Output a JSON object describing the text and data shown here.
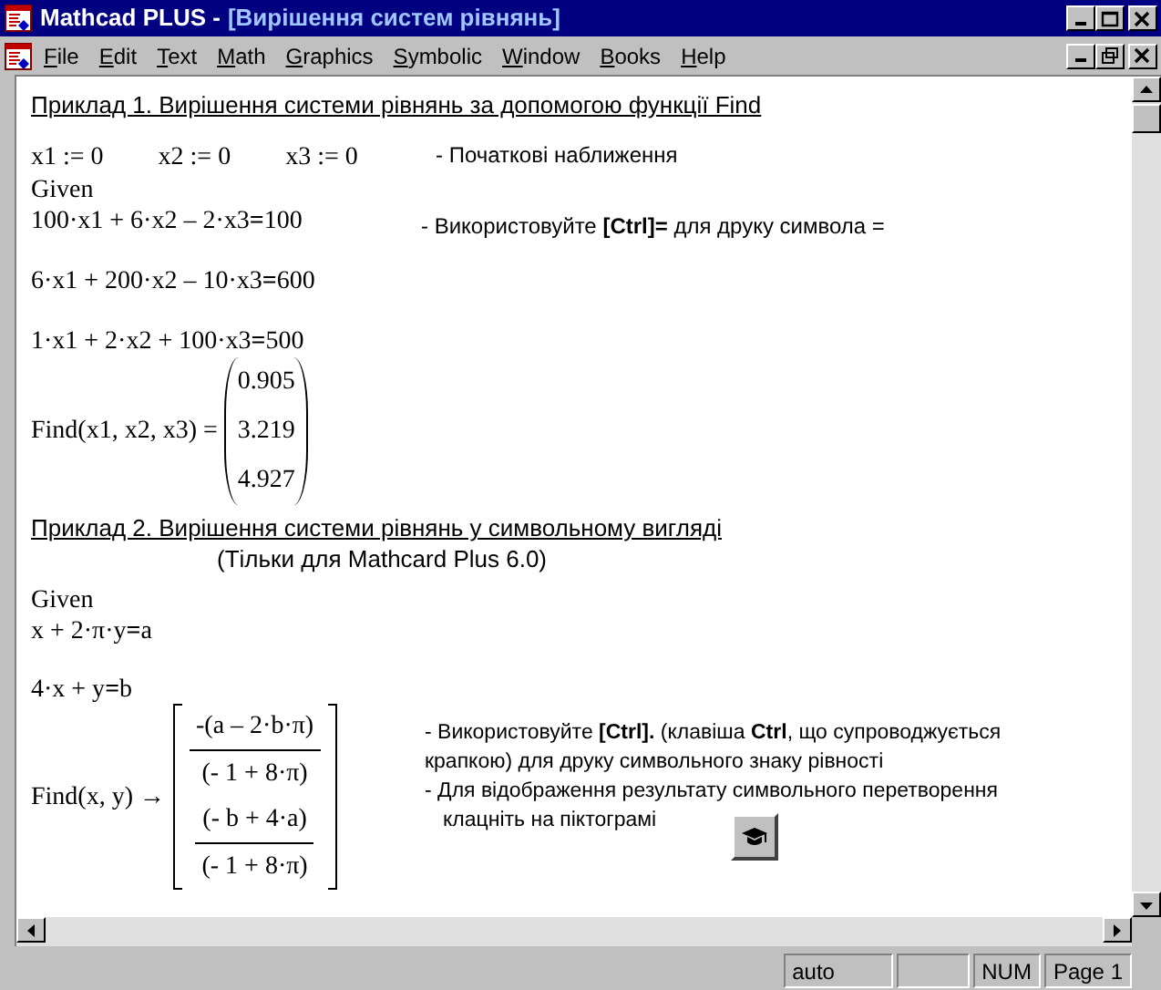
{
  "window": {
    "app_title": "Mathcad PLUS -",
    "document_title": "[Вирішення систем рівнянь]"
  },
  "menu": [
    "File",
    "Edit",
    "Text",
    "Math",
    "Graphics",
    "Symbolic",
    "Window",
    "Books",
    "Help"
  ],
  "example_1": {
    "heading": "Приклад 1. Вирішення системи рівнянь за допомогою функції Find",
    "assignments": [
      "x1 := 0",
      "x2 := 0",
      "x3 := 0"
    ],
    "note": "- Початкові наближення",
    "given": "Given",
    "equations": [
      "100·x1 + 6·x2 – 2·x3**=**100",
      "6·x1 + 200·x2 – 10·x3**=**600",
      "1·x1 + 2·x2 + 100·x3**=**500"
    ],
    "hint": "- Використовуйте **[Ctrl]=** для друку символа =",
    "find": "Find(x1, x2, x3) =",
    "result": [
      "0.905",
      "3.219",
      "4.927"
    ]
  },
  "example_2": {
    "heading": "Приклад 2. Вирішення системи рівнянь у символьному вигляді",
    "subtitle": "(Тільки для Mathcard Plus 6.0)",
    "given": "Given",
    "equations": [
      "x + 2·π·y**=**a",
      "4·x + y**=**b"
    ],
    "find": "Find(x, y) →",
    "result": [
      {
        "numerator": "-(a – 2·b·π)",
        "denominator": "(- 1 + 8·π)"
      },
      {
        "numerator": "(- b + 4·a)",
        "denominator": "(- 1 + 8·π)"
      }
    ],
    "notes": [
      "- Використовуйте **[Ctrl].** (клавіша **Ctrl**, що супроводжується крапкою) для друку символьного знаку рівності",
      "- Для відображення результату символьного перетворення клацніть на піктограмі"
    ]
  },
  "status_bar": [
    "auto",
    "NUM",
    "Page 1"
  ]
}
